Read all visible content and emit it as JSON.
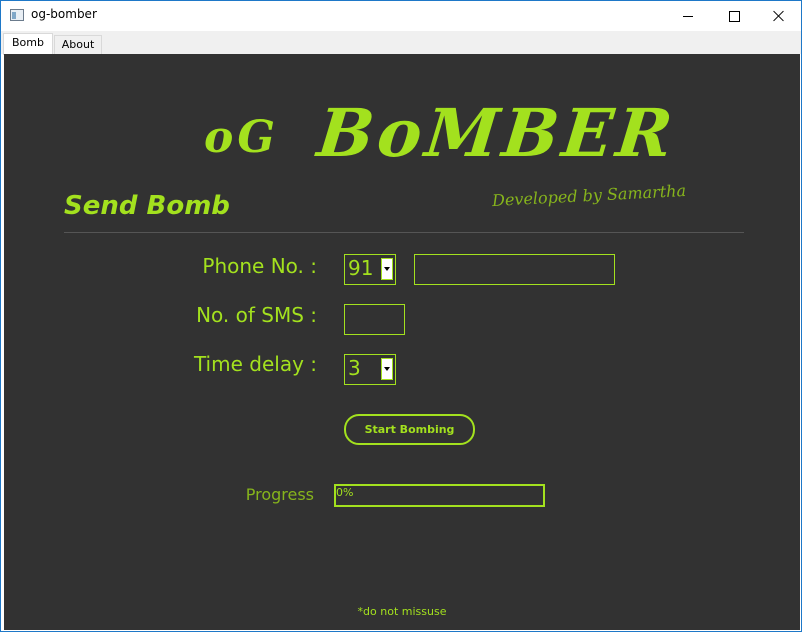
{
  "window": {
    "title": "og-bomber",
    "icon": "app-window-icon",
    "controls": [
      "minimize-icon",
      "maximize-icon",
      "close-icon"
    ]
  },
  "tabs": [
    {
      "label": "Bomb",
      "active": true
    },
    {
      "label": "About",
      "active": false
    }
  ],
  "logo": {
    "part1": "oG",
    "part2": "BoMBER",
    "developed_by": "Developed by Samartha"
  },
  "form": {
    "heading": "Send Bomb",
    "phone_label": "Phone No. :",
    "country_code": "91",
    "phone_value": "",
    "sms_label": "No. of SMS :",
    "sms_value": "",
    "delay_label": "Time delay :",
    "delay_value": "3",
    "start_button": "Start Bombing"
  },
  "progress": {
    "label": "Progress",
    "value": 0,
    "text": "0%"
  },
  "footer": "*do not missuse",
  "colors": {
    "accent": "#a3e11e",
    "background": "#323232"
  }
}
